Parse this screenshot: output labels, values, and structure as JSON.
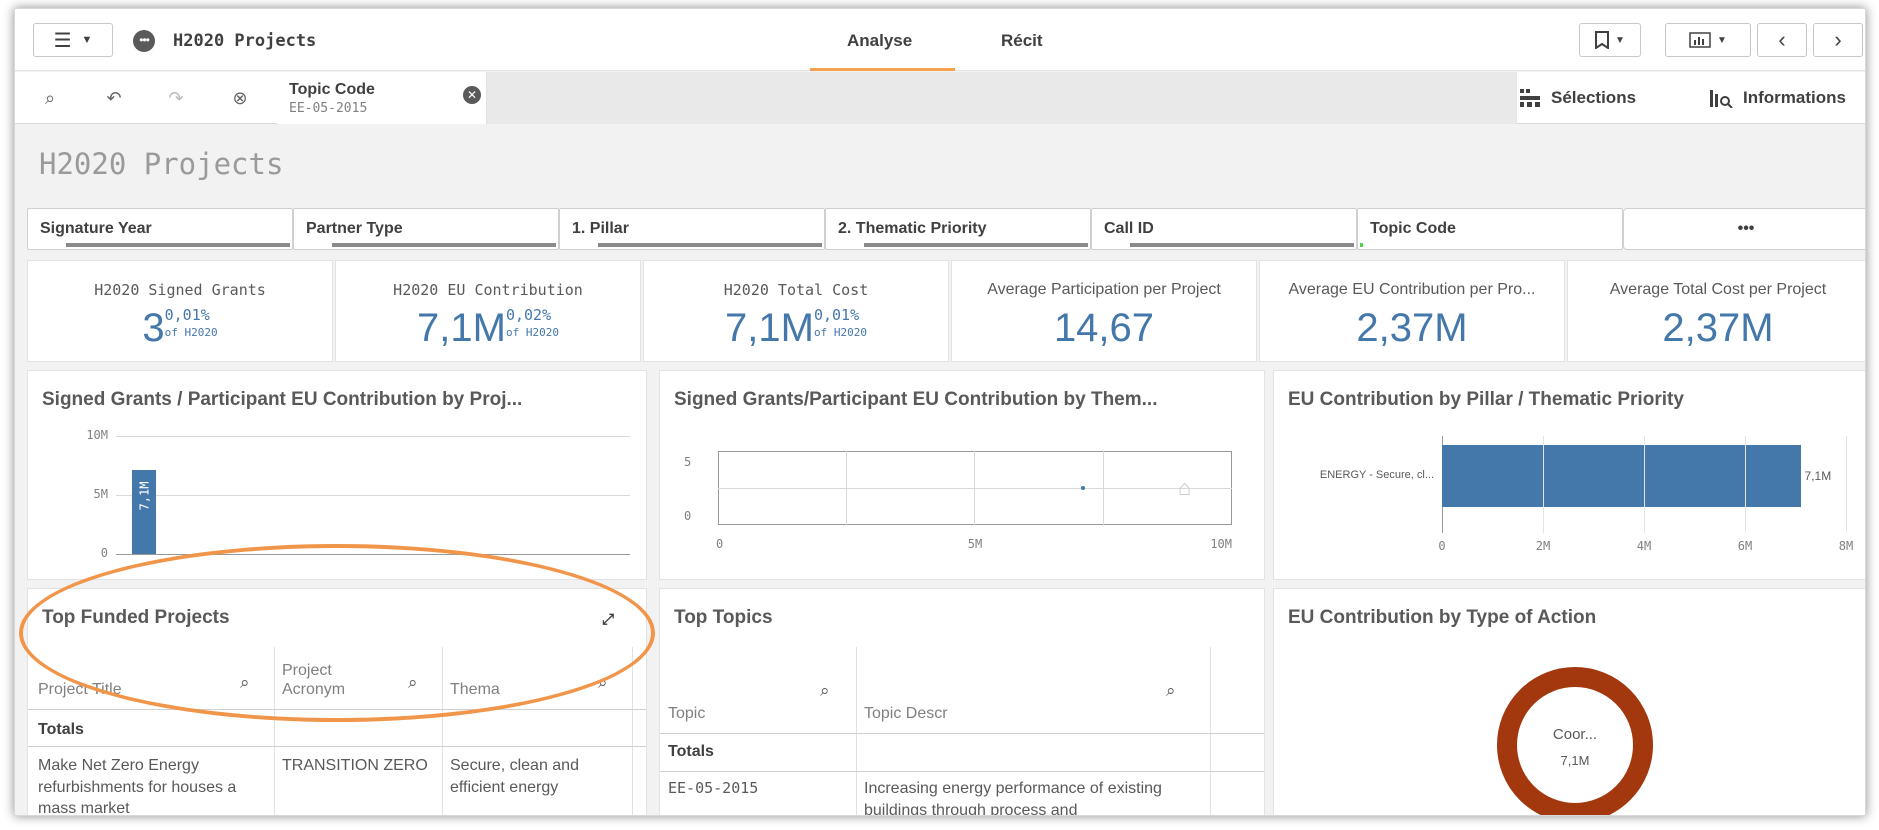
{
  "app": {
    "title": "H2020 Projects",
    "menu_icon": "hamburger-icon",
    "app_icon": "qlik-dots-icon"
  },
  "tabs": [
    {
      "label": "Analyse",
      "active": true
    },
    {
      "label": "Récit",
      "active": false
    }
  ],
  "selection_bar": {
    "field": "Topic Code",
    "value": "EE-05-2015",
    "selections_label": "Sélections",
    "informations_label": "Informations"
  },
  "sheet_title": "H2020 Projects",
  "filters": [
    "Signature Year",
    "Partner Type",
    "1. Pillar",
    "2. Thematic Priority",
    "Call ID",
    "Topic Code",
    "•••"
  ],
  "kpis": [
    {
      "title": "H2020 Signed Grants",
      "value": "3",
      "pct": "0,01%",
      "of": "of H2020"
    },
    {
      "title": "H2020 EU Contribution",
      "value": "7,1M",
      "pct": "0,02%",
      "of": "of H2020"
    },
    {
      "title": "H2020 Total Cost",
      "value": "7,1M",
      "pct": "0,01%",
      "of": "of H2020"
    },
    {
      "title": "Average Participation per Project",
      "value": "14,67"
    },
    {
      "title": "Average EU Contribution per Pro...",
      "value": "2,37M"
    },
    {
      "title": "Average Total Cost per Project",
      "value": "2,37M"
    }
  ],
  "panels": {
    "signed_grants_project": {
      "title": "Signed Grants / Participant EU Contribution by Proj..."
    },
    "signed_grants_thematic": {
      "title": "Signed Grants/Participant EU Contribution by Them..."
    },
    "eu_by_pillar": {
      "title": "EU Contribution by Pillar / Thematic Priority"
    },
    "top_funded": {
      "title": "Top Funded Projects",
      "columns": [
        "Project Title",
        "Project Acronym",
        "Thema"
      ],
      "totals_label": "Totals",
      "rows": [
        {
          "title": "Make Net Zero Energy refurbishments for houses a mass market",
          "acronym": "TRANSITION ZERO",
          "thema": "Secure, clean and efficient energy"
        }
      ]
    },
    "top_topics": {
      "title": "Top Topics",
      "columns": [
        "Topic",
        "Topic Descr"
      ],
      "totals_label": "Totals",
      "rows": [
        {
          "topic": "EE-05-2015",
          "descr": "Increasing energy performance of existing buildings through process and"
        }
      ]
    },
    "eu_by_action": {
      "title": "EU Contribution by Type of Action"
    }
  },
  "chart_data": [
    {
      "type": "bar",
      "title": "Signed Grants / Participant EU Contribution by Proj...",
      "categories": [
        ""
      ],
      "values": [
        7100000
      ],
      "data_labels": [
        "7,1M"
      ],
      "ytick_labels": [
        "10M",
        "5M",
        "0"
      ],
      "ylim": [
        0,
        10000000
      ],
      "color": "#4477aa"
    },
    {
      "type": "scatter",
      "title": "Signed Grants/Participant EU Contribution by Them...",
      "points": [
        {
          "x": 7100000,
          "y": 3
        }
      ],
      "xtick_labels": [
        "0",
        "5M",
        "10M"
      ],
      "ytick_labels": [
        "5",
        "0"
      ],
      "xlim": [
        0,
        10000000
      ],
      "ylim": [
        0,
        6
      ],
      "color": "#4477aa"
    },
    {
      "type": "bar",
      "orientation": "horizontal",
      "title": "EU Contribution by Pillar / Thematic Priority",
      "categories": [
        "ENERGY - Secure, cl..."
      ],
      "values": [
        7100000
      ],
      "data_labels": [
        "7,1M"
      ],
      "xtick_labels": [
        "0",
        "2M",
        "4M",
        "6M",
        "8M"
      ],
      "xlim": [
        0,
        8000000
      ],
      "color": "#4477aa"
    },
    {
      "type": "pie",
      "title": "EU Contribution by Type of Action",
      "slices": [
        {
          "label": "Coor...",
          "value": 7100000,
          "value_label": "7,1M"
        }
      ],
      "color": "#a3380f"
    }
  ]
}
